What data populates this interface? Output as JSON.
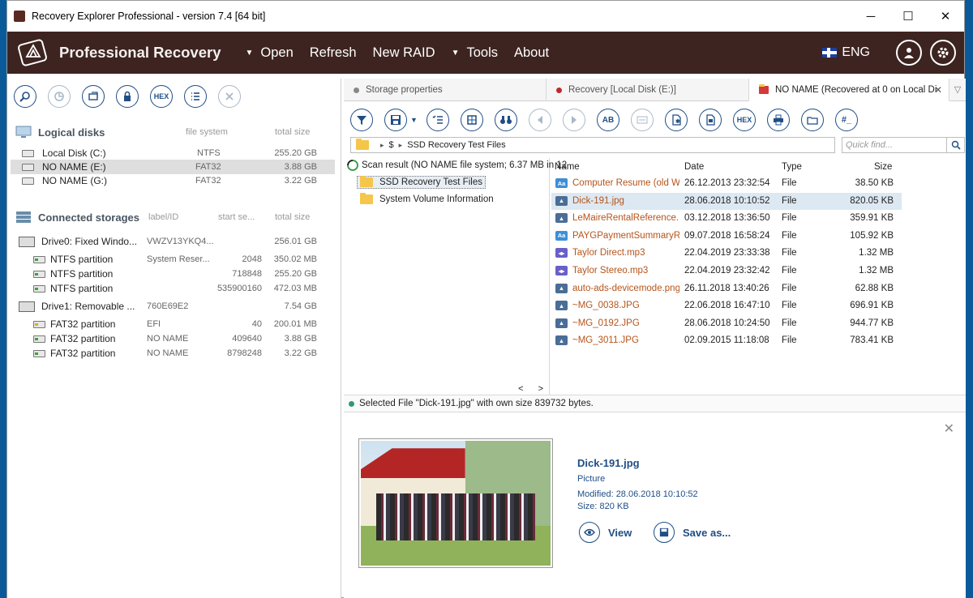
{
  "window": {
    "title": "Recovery Explorer Professional - version 7.4 [64 bit]",
    "min": "─",
    "max": "☐",
    "close": "✕"
  },
  "menu": {
    "brand": "Professional Recovery",
    "items": [
      {
        "label": "Open",
        "arrow": "▼"
      },
      {
        "label": "Refresh"
      },
      {
        "label": "New RAID"
      },
      {
        "label": "Tools",
        "arrow": "▼"
      },
      {
        "label": "About"
      }
    ],
    "lang": "ENG"
  },
  "left_toolbar": [
    "search",
    "scan",
    "open-image",
    "lock",
    "HEX",
    "list",
    "close"
  ],
  "logical": {
    "title": "Logical disks",
    "col1": "file system",
    "col2": "total size",
    "items": [
      {
        "name": "Local Disk (C:)",
        "fs": "NTFS",
        "size": "255.20 GB"
      },
      {
        "name": "NO NAME (E:)",
        "fs": "FAT32",
        "size": "3.88 GB",
        "selected": true
      },
      {
        "name": "NO NAME (G:)",
        "fs": "FAT32",
        "size": "3.22 GB"
      }
    ]
  },
  "storages": {
    "title": "Connected storages",
    "col1": "label/ID",
    "col2": "start se...",
    "col3": "total size",
    "items": [
      {
        "name": "Drive0: Fixed Windo...",
        "label": "VWZV13YKQ4...",
        "start": "",
        "size": "256.01 GB",
        "drive": true
      },
      {
        "name": "NTFS partition",
        "label": "System Reser...",
        "start": "2048",
        "size": "350.02 MB"
      },
      {
        "name": "NTFS partition",
        "label": "",
        "start": "718848",
        "size": "255.20 GB"
      },
      {
        "name": "NTFS partition",
        "label": "",
        "start": "535900160",
        "size": "472.03 MB"
      },
      {
        "name": "Drive1: Removable ...",
        "label": "760E69E2",
        "start": "",
        "size": "7.54 GB",
        "drive": true
      },
      {
        "name": "FAT32 partition",
        "label": "EFI",
        "start": "40",
        "size": "200.01 MB",
        "efi": true
      },
      {
        "name": "FAT32 partition",
        "label": "NO NAME",
        "start": "409640",
        "size": "3.88 GB"
      },
      {
        "name": "FAT32 partition",
        "label": "NO NAME",
        "start": "8798248",
        "size": "3.22 GB"
      }
    ]
  },
  "tabs": [
    {
      "label": "Storage properties",
      "color": "#888888"
    },
    {
      "label": "Recovery [Local Disk (E:)]",
      "color": "#c0282d"
    },
    {
      "label": "NO NAME (Recovered at 0 on Local Di...",
      "color": "#c0282d",
      "active": true
    }
  ],
  "tabs_close": "✕",
  "tabs_menu": "▽",
  "right_toolbar": [
    "filter",
    "save",
    "checklist",
    "grid",
    "binoculars",
    "prev",
    "next",
    "AB",
    "rename",
    "file-star",
    "export",
    "HEX",
    "print",
    "folder-out",
    "#_"
  ],
  "address": {
    "root": "$",
    "path": "SSD Recovery Test Files",
    "quick_find": "Quick find..."
  },
  "tree": {
    "root": "Scan result (NO NAME file system; 6.37 MB in 12",
    "children": [
      "SSD Recovery Test Files",
      "System Volume Information"
    ],
    "scroll_left": "<",
    "scroll_right": ">"
  },
  "files": {
    "columns": [
      "Name",
      "Date",
      "Type",
      "Size"
    ],
    "rows": [
      {
        "name": "Computer Resume (old W...",
        "date": "26.12.2013 23:32:54",
        "type": "File",
        "size": "38.50 KB",
        "icon": "doc"
      },
      {
        "name": "Dick-191.jpg",
        "date": "28.06.2018 10:10:52",
        "type": "File",
        "size": "820.05 KB",
        "icon": "img",
        "selected": true
      },
      {
        "name": "LeMaireRentalReference...",
        "date": "03.12.2018 13:36:50",
        "type": "File",
        "size": "359.91 KB",
        "icon": "img"
      },
      {
        "name": "PAYGPaymentSummaryR...",
        "date": "09.07.2018 16:58:24",
        "type": "File",
        "size": "105.92 KB",
        "icon": "doc"
      },
      {
        "name": "Taylor Direct.mp3",
        "date": "22.04.2019 23:33:38",
        "type": "File",
        "size": "1.32 MB",
        "icon": "audio"
      },
      {
        "name": "Taylor Stereo.mp3",
        "date": "22.04.2019 23:32:42",
        "type": "File",
        "size": "1.32 MB",
        "icon": "audio"
      },
      {
        "name": "auto-ads-devicemode.png",
        "date": "26.11.2018 13:40:26",
        "type": "File",
        "size": "62.88 KB",
        "icon": "img"
      },
      {
        "name": "~MG_0038.JPG",
        "date": "22.06.2018 16:47:10",
        "type": "File",
        "size": "696.91 KB",
        "icon": "img"
      },
      {
        "name": "~MG_0192.JPG",
        "date": "28.06.2018 10:24:50",
        "type": "File",
        "size": "944.77 KB",
        "icon": "img"
      },
      {
        "name": "~MG_3011.JPG",
        "date": "02.09.2015 11:18:08",
        "type": "File",
        "size": "783.41 KB",
        "icon": "img"
      }
    ]
  },
  "status": "Selected File \"Dick-191.jpg\" with own size 839732 bytes.",
  "preview": {
    "name": "Dick-191.jpg",
    "kind": "Picture",
    "modified": "Modified: 28.06.2018 10:10:52",
    "size": "Size: 820 KB",
    "view": "View",
    "save": "Save as...",
    "close": "✕"
  }
}
